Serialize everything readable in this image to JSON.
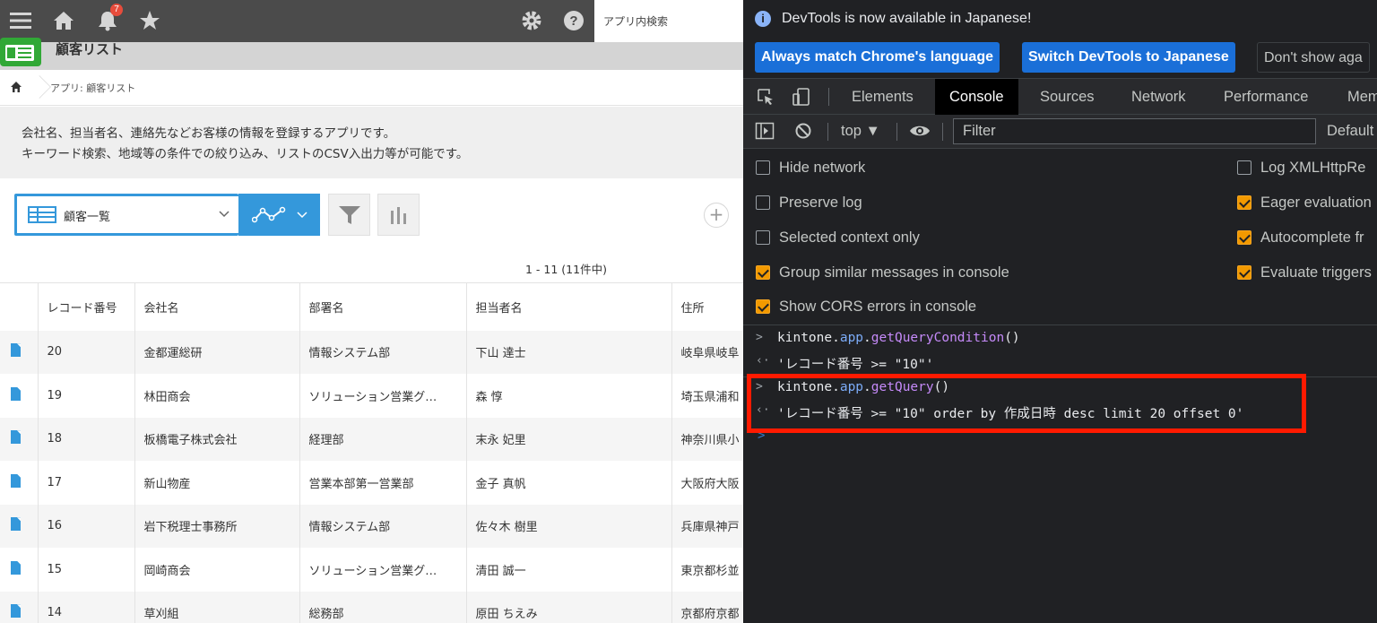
{
  "kintone": {
    "notification_count": "7",
    "search_placeholder": "アプリ内検索",
    "app_title": "顧客リスト",
    "breadcrumb": "アプリ: 顧客リスト",
    "description_line1": "会社名、担当者名、連絡先などお客様の情報を登録するアプリです。",
    "description_line2": "キーワード検索、地域等の条件での絞り込み、リストのCSV入出力等が可能です。",
    "view_name": "顧客一覧",
    "record_count": "1 - 11  (11件中)",
    "columns": [
      "レコード番号",
      "会社名",
      "部署名",
      "担当者名",
      "住所"
    ],
    "rows": [
      {
        "id": "20",
        "company": "金都運総研",
        "dept": "情報システム部",
        "person": "下山 達士",
        "address": "岐阜県岐阜"
      },
      {
        "id": "19",
        "company": "林田商会",
        "dept": "ソリューション営業グ…",
        "person": "森 惇",
        "address": "埼玉県浦和"
      },
      {
        "id": "18",
        "company": "板橋電子株式会社",
        "dept": "経理部",
        "person": "末永 妃里",
        "address": "神奈川県小"
      },
      {
        "id": "17",
        "company": "新山物産",
        "dept": "営業本部第一営業部",
        "person": "金子 真帆",
        "address": "大阪府大阪"
      },
      {
        "id": "16",
        "company": "岩下税理士事務所",
        "dept": "情報システム部",
        "person": "佐々木 樹里",
        "address": "兵庫県神戸"
      },
      {
        "id": "15",
        "company": "岡崎商会",
        "dept": "ソリューション営業グ…",
        "person": "清田 誠一",
        "address": "東京都杉並"
      },
      {
        "id": "14",
        "company": "草刈組",
        "dept": "総務部",
        "person": "原田 ちえみ",
        "address": "京都府京都"
      }
    ]
  },
  "devtools": {
    "info_message": "DevTools is now available in Japanese!",
    "btn_match": "Always match Chrome's language",
    "btn_switch": "Switch DevTools to Japanese",
    "btn_dont_show": "Don't show aga",
    "tabs": [
      "Elements",
      "Console",
      "Sources",
      "Network",
      "Performance",
      "Mem"
    ],
    "active_tab": "Console",
    "context": "top ▼",
    "filter_placeholder": "Filter",
    "levels": "Default",
    "settings_left": [
      {
        "label": "Hide network",
        "checked": false
      },
      {
        "label": "Preserve log",
        "checked": false
      },
      {
        "label": "Selected context only",
        "checked": false
      },
      {
        "label": "Group similar messages in console",
        "checked": true
      },
      {
        "label": "Show CORS errors in console",
        "checked": true
      }
    ],
    "settings_right": [
      {
        "label": "Log XMLHttpRe",
        "checked": false
      },
      {
        "label": "Eager evaluation",
        "checked": true
      },
      {
        "label": "Autocomplete fr",
        "checked": true
      },
      {
        "label": "Evaluate triggers",
        "checked": true
      }
    ],
    "console": {
      "cmd1_obj": "kintone",
      "cmd1_prop": "app",
      "cmd1_fn": "getQueryCondition",
      "cmd1_args": "()",
      "out1": "'レコード番号 >= \"10\"'",
      "cmd2_obj": "kintone",
      "cmd2_prop": "app",
      "cmd2_fn": "getQuery",
      "cmd2_args": "()",
      "out2": "'レコード番号 >= \"10\" order by 作成日時 desc limit 20 offset 0'"
    },
    "highlight_color": "#ff1a00"
  }
}
